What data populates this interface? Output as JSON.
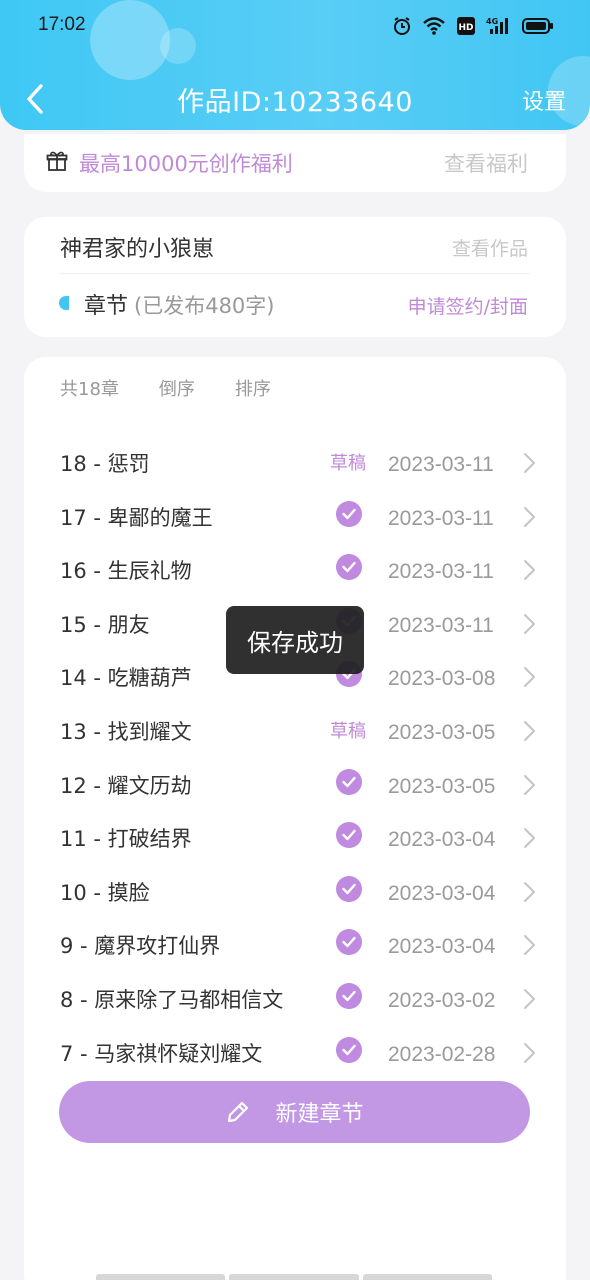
{
  "status_bar": {
    "time": "17:02",
    "icons": [
      "alarm-icon",
      "wifi-icon",
      "hd-icon",
      "signal-4g-icon",
      "battery-icon"
    ],
    "hd_label": "HD",
    "network_label": "4G"
  },
  "header": {
    "title": "作品ID:10233640",
    "settings_label": "设置",
    "back_icon": "chevron-left-icon",
    "background_color": "#41c6f3"
  },
  "welfare": {
    "icon": "gift-icon",
    "text": "最高10000元创作福利",
    "link": "查看福利",
    "accent_color": "#c08ad8"
  },
  "work": {
    "title": "神君家的小狼崽",
    "view_link": "查看作品",
    "chapter_label": "章节",
    "chapter_meta": "(已发布480字)",
    "apply_link": "申请签约/封面"
  },
  "list": {
    "count_label": "共18章",
    "reverse_label": "倒序",
    "sort_label": "排序",
    "rows": [
      {
        "title": "18 - 惩罚",
        "status": "draft",
        "status_label": "草稿",
        "date": "2023-03-11"
      },
      {
        "title": "17 - 卑鄙的魔王",
        "status": "published",
        "status_label": "",
        "date": "2023-03-11"
      },
      {
        "title": "16 - 生辰礼物",
        "status": "published",
        "status_label": "",
        "date": "2023-03-11"
      },
      {
        "title": "15 - 朋友",
        "status": "published",
        "status_label": "",
        "date": "2023-03-11"
      },
      {
        "title": "14 - 吃糖葫芦",
        "status": "published",
        "status_label": "",
        "date": "2023-03-08"
      },
      {
        "title": "13 - 找到耀文",
        "status": "draft",
        "status_label": "草稿",
        "date": "2023-03-05"
      },
      {
        "title": "12 - 耀文历劫",
        "status": "published",
        "status_label": "",
        "date": "2023-03-05"
      },
      {
        "title": "11 - 打破结界",
        "status": "published",
        "status_label": "",
        "date": "2023-03-04"
      },
      {
        "title": "10 - 摸脸",
        "status": "published",
        "status_label": "",
        "date": "2023-03-04"
      },
      {
        "title": "9 - 魔界攻打仙界",
        "status": "published",
        "status_label": "",
        "date": "2023-03-04"
      },
      {
        "title": "8 - 原来除了马都相信文",
        "status": "published",
        "status_label": "",
        "date": "2023-03-02"
      },
      {
        "title": "7 - 马家祺怀疑刘耀文",
        "status": "published",
        "status_label": "",
        "date": "2023-02-28"
      }
    ]
  },
  "new_chapter": {
    "label": "新建章节",
    "icon": "pencil-icon",
    "color": "#c298e4"
  },
  "toast": {
    "text": "保存成功"
  }
}
